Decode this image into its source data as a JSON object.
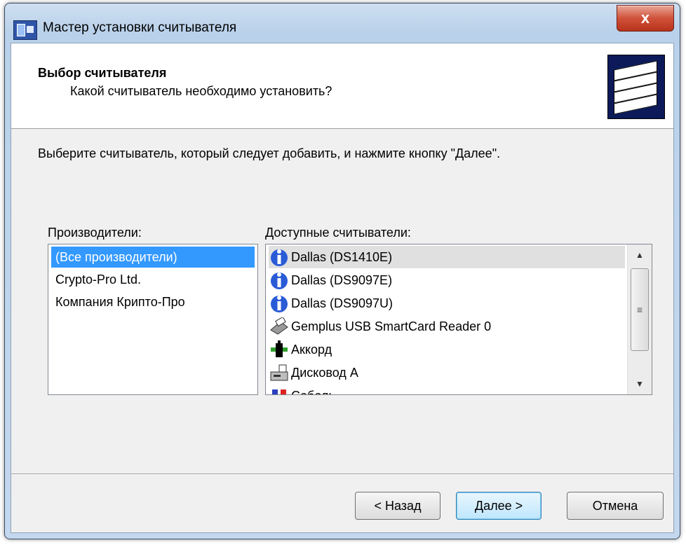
{
  "window": {
    "title": "Мастер установки считывателя",
    "close_label": "x"
  },
  "header": {
    "title": "Выбор считывателя",
    "subtitle": "Какой считыватель необходимо установить?"
  },
  "instruction": "Выберите считыватель, который следует добавить, и нажмите кнопку \"Далее\".",
  "manufacturers": {
    "label": "Производители:",
    "items": [
      {
        "label": "(Все производители)",
        "selected": true
      },
      {
        "label": "Crypto-Pro Ltd."
      },
      {
        "label": "Компания Крипто-Про"
      }
    ]
  },
  "readers": {
    "label": "Доступные считыватели:",
    "items": [
      {
        "label": "Dallas (DS1410E)",
        "icon": "dallas-key-icon",
        "selected": true
      },
      {
        "label": "Dallas (DS9097E)",
        "icon": "dallas-key-icon"
      },
      {
        "label": "Dallas (DS9097U)",
        "icon": "dallas-key-icon"
      },
      {
        "label": "Gemplus USB SmartCard Reader 0",
        "icon": "smartcard-reader-icon"
      },
      {
        "label": "Аккорд",
        "icon": "accord-icon"
      },
      {
        "label": "Дисковод А",
        "icon": "floppy-drive-icon"
      },
      {
        "label": "Соболь",
        "icon": "sobol-icon"
      }
    ]
  },
  "buttons": {
    "back": "< Назад",
    "next": "Далее >",
    "cancel": "Отмена"
  }
}
